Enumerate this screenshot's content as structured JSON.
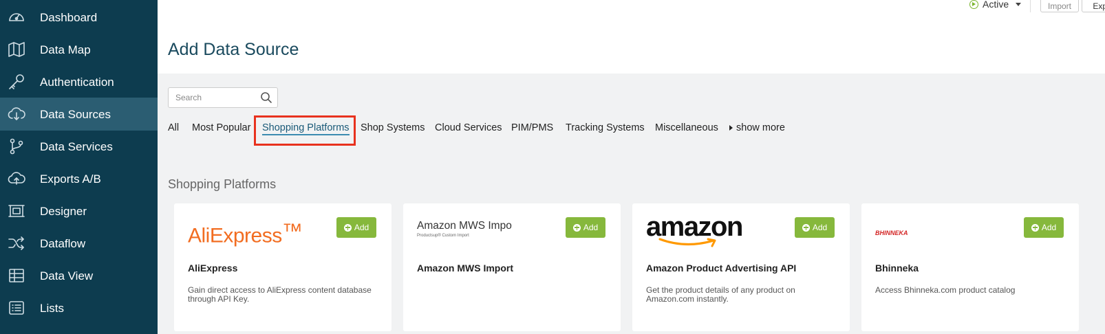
{
  "sidebar": {
    "items": [
      {
        "label": "Dashboard",
        "icon": "gauge-icon",
        "active": false
      },
      {
        "label": "Data Map",
        "icon": "map-icon",
        "active": false
      },
      {
        "label": "Authentication",
        "icon": "key-icon",
        "active": false
      },
      {
        "label": "Data Sources",
        "icon": "cloud-download-icon",
        "active": true
      },
      {
        "label": "Data Services",
        "icon": "git-branch-icon",
        "active": false
      },
      {
        "label": "Exports A/B",
        "icon": "cloud-upload-icon",
        "active": false
      },
      {
        "label": "Designer",
        "icon": "frame-icon",
        "active": false
      },
      {
        "label": "Dataflow",
        "icon": "shuffle-icon",
        "active": false
      },
      {
        "label": "Data View",
        "icon": "table-icon",
        "active": false
      },
      {
        "label": "Lists",
        "icon": "list-icon",
        "active": false
      }
    ],
    "background": "#0d3c4f",
    "active_background": "#2b5d72"
  },
  "header": {
    "title": "Add Data Source",
    "status": "Active",
    "import_label": "Import",
    "export_label": "Expo"
  },
  "search": {
    "placeholder": "Search",
    "value": ""
  },
  "tabs": [
    {
      "label": "All",
      "active": false
    },
    {
      "label": "Most Popular",
      "active": false
    },
    {
      "label": "Shopping Platforms",
      "active": true
    },
    {
      "label": "Shop Systems",
      "active": false
    },
    {
      "label": "Cloud Services",
      "active": false
    },
    {
      "label": "PIM/PMS",
      "active": false
    },
    {
      "label": "Tracking Systems",
      "active": false
    },
    {
      "label": "Miscellaneous",
      "active": false
    },
    {
      "label": "show more",
      "active": false
    }
  ],
  "highlight_color": "#e8321e",
  "section": {
    "title": "Shopping Platforms"
  },
  "cards": [
    {
      "logo_text": "AliExpress",
      "logo_mark": "™",
      "title": "AliExpress",
      "description": "Gain direct access to AliExpress content database through API Key.",
      "add_label": "Add"
    },
    {
      "logo_text": "Amazon MWS Impo",
      "logo_subtext": "Productsup® Custom Import",
      "title": "Amazon MWS Import",
      "description": "",
      "add_label": "Add"
    },
    {
      "logo_text": "amazon",
      "title": "Amazon Product Advertising API",
      "description": "Get the product details of any product on Amazon.com instantly.",
      "add_label": "Add"
    },
    {
      "logo_text": "BHINNEKA",
      "title": "Bhinneka",
      "description": "Access Bhinneka.com product catalog",
      "add_label": "Add"
    }
  ],
  "colors": {
    "accent_green": "#86b83c",
    "title_blue": "#1a4a5e",
    "aliexpress_orange": "#f26d21",
    "amazon_orange": "#ff9900"
  }
}
